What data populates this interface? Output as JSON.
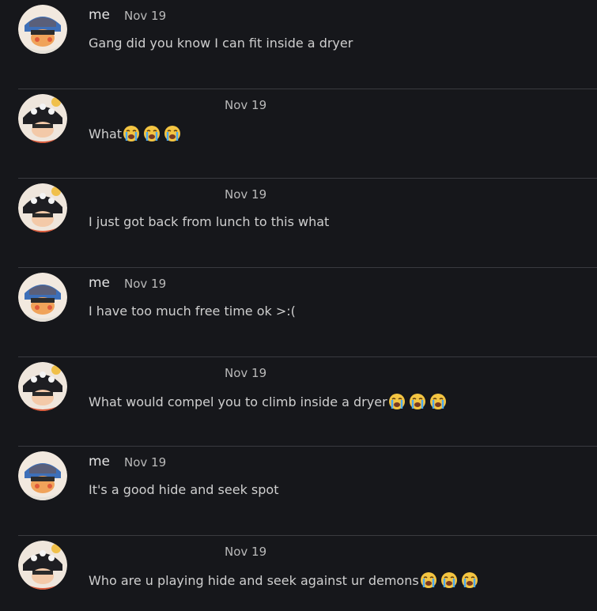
{
  "messages": [
    {
      "author": "me",
      "date": "Nov 19",
      "text": "Gang did you know I can fit inside a dryer",
      "avatar": "me-avatar",
      "emoji_count": 0
    },
    {
      "author": "",
      "date": "Nov 19",
      "text": "What",
      "avatar": "friend-avatar",
      "emoji_count": 3
    },
    {
      "author": "",
      "date": "Nov 19",
      "text": "I just got back from lunch to this what",
      "avatar": "friend-avatar",
      "emoji_count": 0
    },
    {
      "author": "me",
      "date": "Nov 19",
      "text": "I have too much free time ok >:(",
      "avatar": "me-avatar",
      "emoji_count": 0
    },
    {
      "author": "",
      "date": "Nov 19",
      "text": "What would compel you to climb inside a dryer",
      "avatar": "friend-avatar",
      "emoji_count": 3
    },
    {
      "author": "me",
      "date": "Nov 19",
      "text": "It's a good hide and seek spot",
      "avatar": "me-avatar",
      "emoji_count": 0
    },
    {
      "author": "",
      "date": "Nov 19",
      "text": "Who are u playing hide and seek against ur demons",
      "avatar": "friend-avatar",
      "emoji_count": 3
    }
  ],
  "emoji": "loudly-crying-face",
  "colors": {
    "background": "#16171b",
    "divider": "#3a3b40",
    "emoji": "#f4c542"
  }
}
